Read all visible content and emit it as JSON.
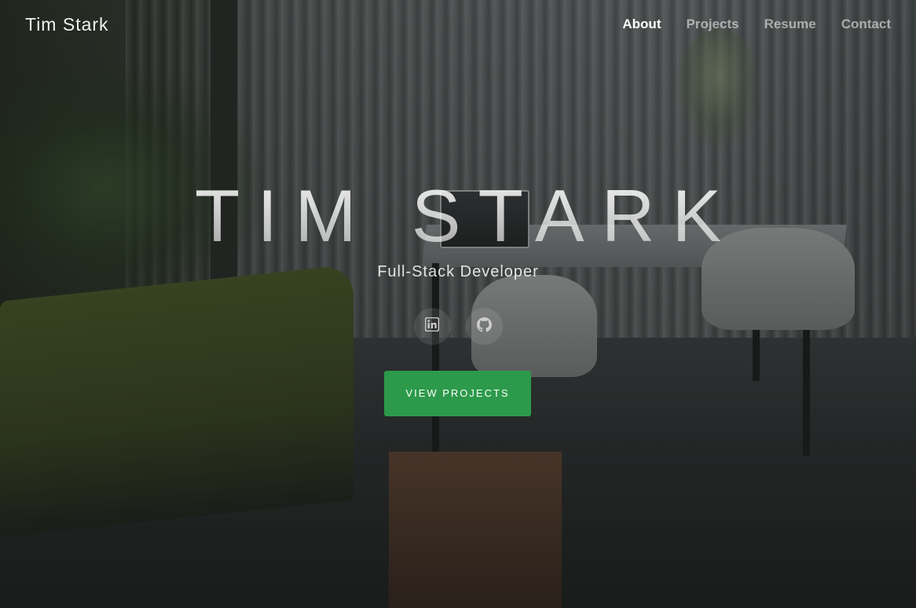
{
  "nav": {
    "brand": "Tim Stark",
    "links": [
      {
        "label": "About",
        "active": true
      },
      {
        "label": "Projects",
        "active": false
      },
      {
        "label": "Resume",
        "active": false
      },
      {
        "label": "Contact",
        "active": false
      }
    ]
  },
  "hero": {
    "title": "TIM STARK",
    "subtitle": "Full-Stack Developer",
    "social": [
      {
        "icon": "linkedin-icon"
      },
      {
        "icon": "github-icon"
      }
    ],
    "cta_label": "VIEW PROJECTS"
  },
  "colors": {
    "accent": "#2c9a4a",
    "text": "#ffffff"
  }
}
